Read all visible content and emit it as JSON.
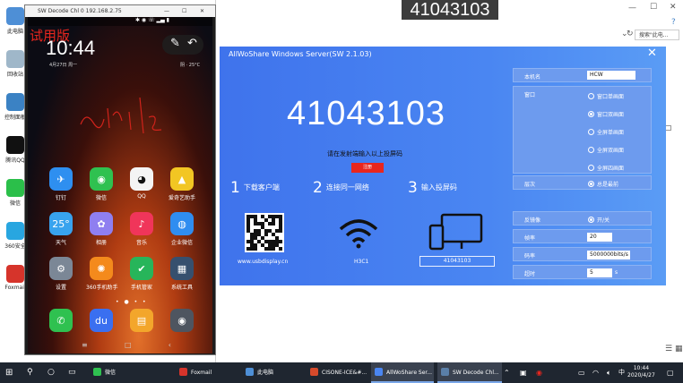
{
  "desktop": {
    "icons": [
      {
        "label": "此电脑",
        "color": "#4e8fd6"
      },
      {
        "label": "回收站",
        "color": "#9fb7c9"
      },
      {
        "label": "控制面板",
        "color": "#3b82c4"
      },
      {
        "label": "腾讯QQ",
        "color": "#111111"
      },
      {
        "label": "微信",
        "color": "#2bbf4a"
      },
      {
        "label": "360安全",
        "color": "#28a6e0"
      },
      {
        "label": "Foxmail",
        "color": "#d6342b"
      }
    ]
  },
  "explorer": {
    "title": "41043103",
    "search_placeholder": "搜索\"此电...",
    "refresh_icon": "refresh-icon"
  },
  "phone_window": {
    "title": "SW Decode Chl 0  192.168.2.75",
    "watermark": "试用版",
    "time": "10:44",
    "date": "4月27日 周一",
    "weather": "阴 · 25°C",
    "apps": [
      {
        "label": "钉钉",
        "bg": "#2e8ff0",
        "glyph": "✈"
      },
      {
        "label": "微信",
        "bg": "#2fc150",
        "glyph": "◉"
      },
      {
        "label": "QQ",
        "bg": "#f4f4f4",
        "glyph": "◕"
      },
      {
        "label": "爱奇艺助手",
        "bg": "#f2c623",
        "glyph": "▲"
      },
      {
        "label": "天气",
        "bg": "#38a3ee",
        "glyph": "25°"
      },
      {
        "label": "相册",
        "bg": "#8f7ff0",
        "glyph": "✿"
      },
      {
        "label": "音乐",
        "bg": "#f0355a",
        "glyph": "♪"
      },
      {
        "label": "企业微信",
        "bg": "#2f8df0",
        "glyph": "◍"
      },
      {
        "label": "设置",
        "bg": "#7b8796",
        "glyph": "⚙"
      },
      {
        "label": "360手机助手",
        "bg": "#f48a1c",
        "glyph": "✺"
      },
      {
        "label": "手机管家",
        "bg": "#27b55a",
        "glyph": "✔"
      },
      {
        "label": "系统工具",
        "bg": "#36506e",
        "glyph": "▦"
      }
    ],
    "dock": [
      {
        "label": "电话",
        "bg": "#2fc150",
        "glyph": "✆"
      },
      {
        "label": "百度",
        "bg": "#3a6ff0",
        "glyph": "du"
      },
      {
        "label": "备忘录",
        "bg": "#f3a62b",
        "glyph": "▤"
      },
      {
        "label": "相机",
        "bg": "#4e5560",
        "glyph": "◉"
      }
    ]
  },
  "server": {
    "title": "AllWoShare Windows Server(SW 2.1.03)",
    "code": "41043103",
    "hint": "请在发射端输入以上投屏码",
    "register_label": "注册",
    "steps": [
      {
        "num": "1",
        "text": "下载客户端"
      },
      {
        "num": "2",
        "text": "连接同一网络"
      },
      {
        "num": "3",
        "text": "输入投屏码"
      }
    ],
    "url": "www.usbdisplay.cn",
    "network_name": "H3C1",
    "code_box": "41043103",
    "settings": {
      "hostname_label": "本机名",
      "hostname_value": "HCW",
      "window_label": "窗口",
      "window_options": [
        {
          "label": "窗口单画面",
          "checked": false
        },
        {
          "label": "窗口双画面",
          "checked": true
        },
        {
          "label": "全屏单画面",
          "checked": false
        },
        {
          "label": "全屏双画面",
          "checked": false
        },
        {
          "label": "全屏四画面",
          "checked": false
        }
      ],
      "layer_label": "层次",
      "layer_option": "总是最前",
      "mirror_label": "反镜像",
      "mirror_option": "开/关",
      "fps_label": "帧率",
      "fps_value": "20",
      "bitrate_label": "码率",
      "bitrate_value": "5000000bits/s",
      "timeout_label": "超时",
      "timeout_value": "5",
      "timeout_unit": "s"
    }
  },
  "taskbar": {
    "items": [
      {
        "label": "微信",
        "color": "#2fc150"
      },
      {
        "label": "Foxmail",
        "color": "#d6342b"
      },
      {
        "label": "此电脑",
        "color": "#4e8fd6"
      },
      {
        "label": "CISONE-ICE&#...",
        "color": "#d64a2b"
      },
      {
        "label": "AllWoShare Ser...",
        "color": "#4a86f2"
      },
      {
        "label": "SW Decode Chl...",
        "color": "#5a7fa8"
      }
    ],
    "time": "10:44",
    "date": "2020/4/27"
  }
}
